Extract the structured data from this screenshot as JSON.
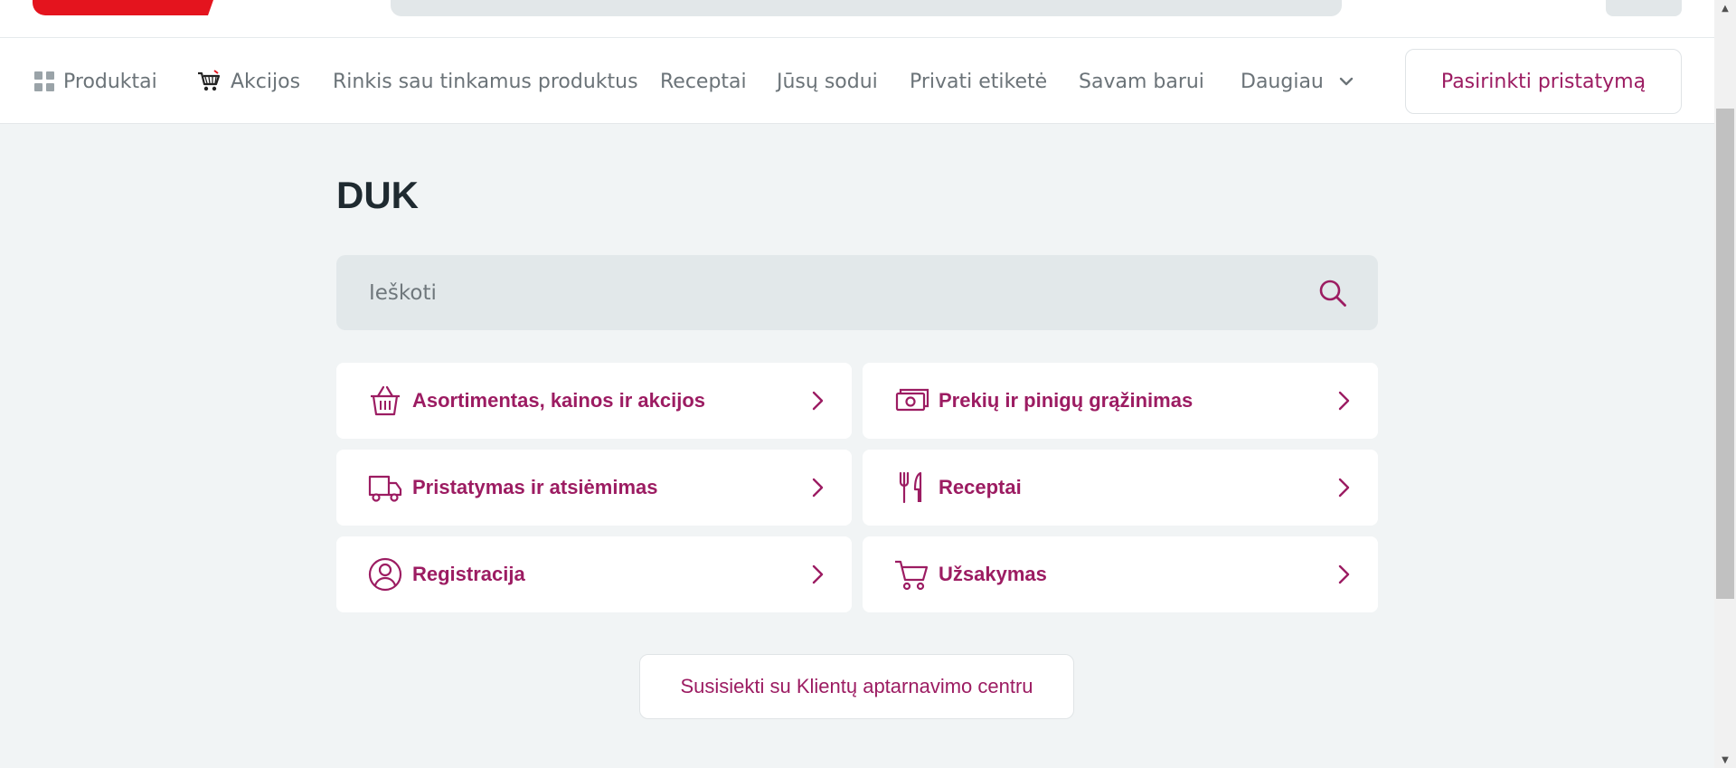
{
  "nav": {
    "items": [
      {
        "label": "Produktai",
        "icon": "grid-icon"
      },
      {
        "label": "Akcijos",
        "icon": "shopping-cart-icon"
      },
      {
        "label": "Rinkis sau tinkamus produktus"
      },
      {
        "label": "Receptai"
      },
      {
        "label": "Jūsų sodui"
      },
      {
        "label": "Privati etiketė"
      },
      {
        "label": "Savam barui"
      },
      {
        "label": "Daugiau",
        "icon": "chevron-down-icon"
      }
    ],
    "delivery_button": "Pasirinkti pristatymą"
  },
  "page": {
    "title": "DUK",
    "search_placeholder": "Ieškoti"
  },
  "categories": [
    {
      "label": "Asortimentas, kainos ir akcijos",
      "icon": "basket-icon"
    },
    {
      "label": "Prekių ir pinigų grąžinimas",
      "icon": "money-icon"
    },
    {
      "label": "Pristatymas ir atsiėmimas",
      "icon": "delivery-truck-icon"
    },
    {
      "label": "Receptai",
      "icon": "cutlery-icon"
    },
    {
      "label": "Registracija",
      "icon": "user-icon"
    },
    {
      "label": "Užsakymas",
      "icon": "cart-icon"
    }
  ],
  "contact_button": "Susisiekti su Klientų aptarnavimo centru",
  "colors": {
    "brand_red": "#e4141e",
    "accent": "#9c1c62",
    "background": "#f1f4f5"
  }
}
